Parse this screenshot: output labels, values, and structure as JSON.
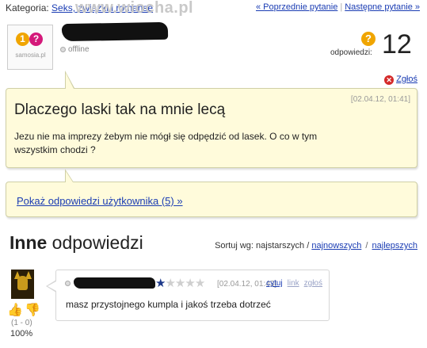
{
  "topbar": {
    "category_label": "Kategoria:",
    "category_link": "Seks, związki i romanse",
    "watermark": "www.wiocha.pl",
    "prev_label": "« Poprzednie pytanie",
    "next_label": "Następne pytanie »"
  },
  "asker": {
    "avatar_caption": "samosia.pl",
    "avatar_glyph_1": "1",
    "avatar_glyph_2": "?",
    "status": "offline"
  },
  "answers_counter": {
    "icon_glyph": "?",
    "label": "odpowiedzi:",
    "count": "12"
  },
  "report": {
    "label": "Zgłoś",
    "icon_glyph": "✕"
  },
  "question": {
    "title": "Dlaczego laski tak na mnie lecą",
    "date": "[02.04.12, 01:41]",
    "body": "Jezu nie ma imprezy żebym nie mógł się odpędzić od lasek. O co w tym wszystkim chodzi ?"
  },
  "user_answers": {
    "link": "Pokaż odpowiedzi użytkownika (5) »"
  },
  "other_answers": {
    "heading_bold": "Inne",
    "heading_rest": " odpowiedzi",
    "sort_label": "Sortuj wg: najstarszych /",
    "sort_newest": "najnowszych",
    "sort_sep": "/",
    "sort_best": "najlepszych"
  },
  "answer": {
    "rating": 1,
    "rating_max": 5,
    "date": "[02.04.12, 01:43]",
    "cite": "cytuj",
    "link": "link",
    "report": "zgłoś",
    "text": "masz przystojnego kumpla i jakoś trzeba dotrzeć",
    "votes": "(1 - 0)",
    "percent": "100%"
  },
  "colors": {
    "link": "#1a3cb3",
    "box_bg": "#fffbdb",
    "accent_orange": "#f0a500",
    "report_red": "#d42a2a",
    "star_on": "#1e3a8a"
  }
}
